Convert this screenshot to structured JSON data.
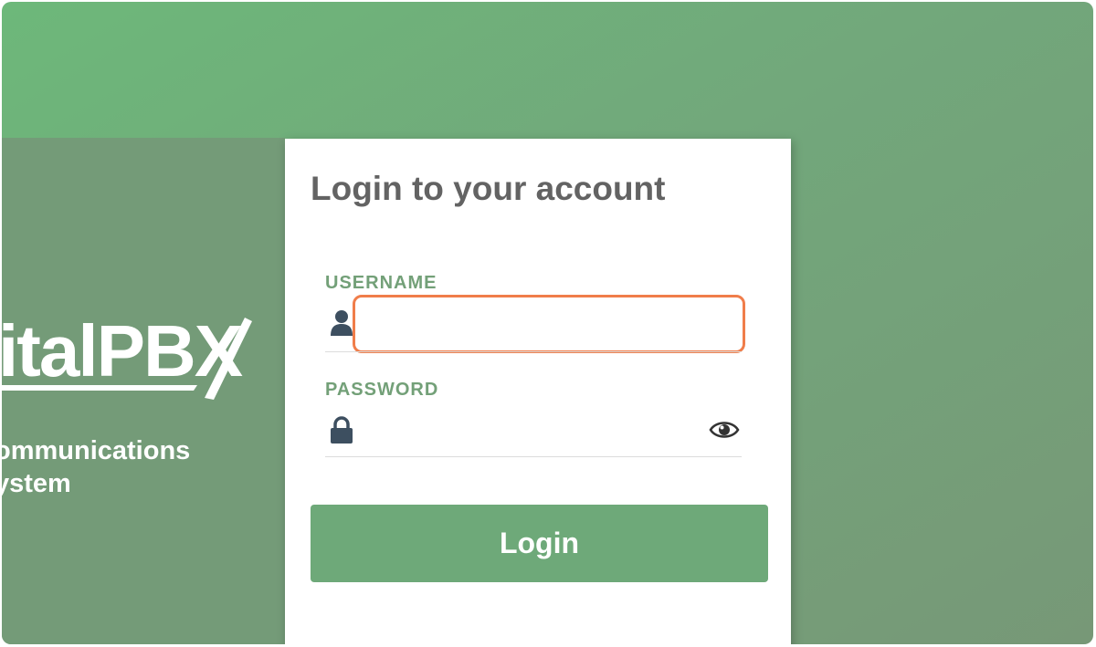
{
  "brand": {
    "logo_text": "italPBX",
    "tagline_line1": "ommunications",
    "tagline_line2": "ystem"
  },
  "login": {
    "title": "Login to your account",
    "username_label": "USERNAME",
    "username_value": "",
    "password_label": "PASSWORD",
    "password_value": "",
    "submit_label": "Login"
  },
  "icons": {
    "username": "user-icon",
    "password": "lock-icon",
    "reveal": "eye-icon"
  },
  "colors": {
    "accent_green": "#6ea979",
    "label_green": "#73a078",
    "focus_highlight": "#f07d4a",
    "title_gray": "#636363",
    "icon_slate": "#3d4f60"
  }
}
